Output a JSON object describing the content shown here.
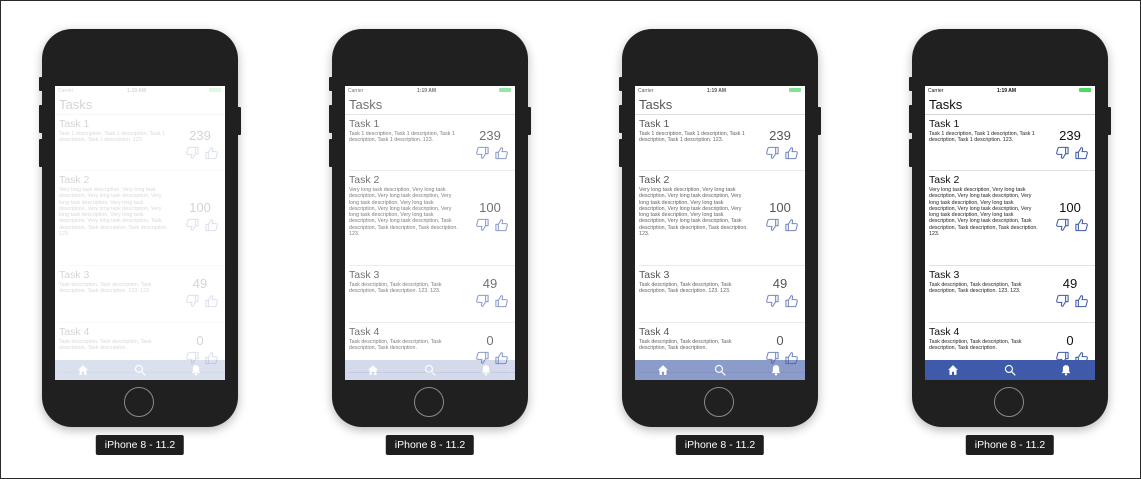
{
  "accent_color": "#3f5aa8",
  "phones": [
    {
      "device_label": "iPhone 8 - 11.2",
      "content_opacity": 0.18,
      "tabbar_opacity": 0.18
    },
    {
      "device_label": "iPhone 8 - 11.2",
      "content_opacity": 0.6,
      "tabbar_opacity": 0.22
    },
    {
      "device_label": "iPhone 8 - 11.2",
      "content_opacity": 0.72,
      "tabbar_opacity": 0.6
    },
    {
      "device_label": "iPhone 8 - 11.2",
      "content_opacity": 1.0,
      "tabbar_opacity": 1.0
    }
  ],
  "app": {
    "status": {
      "carrier": "Carrier",
      "time": "1:19 AM"
    },
    "nav_title": "Tasks",
    "tasks": [
      {
        "title": "Task 1",
        "description": "Task 1 description, Task 1 description, Task 1 description, Task 1 description. 123.",
        "votes": "239"
      },
      {
        "title": "Task 2",
        "description": "Very long task description, Very long task description, Very long task description, Very long task description, Very long task description, Very long task description, Very long task description, Very long task description, Very long task description, Task description, Task description, Task description. 123.",
        "votes": "100"
      },
      {
        "title": "Task 3",
        "description": "Task description, Task description, Task description, Task description. 123. 123.",
        "votes": "49"
      },
      {
        "title": "Task 4",
        "description": "Task description, Task description, Task description, Task description.",
        "votes": "0"
      }
    ],
    "tabs": [
      {
        "icon": "home-icon"
      },
      {
        "icon": "search-icon"
      },
      {
        "icon": "bell-icon"
      }
    ]
  }
}
